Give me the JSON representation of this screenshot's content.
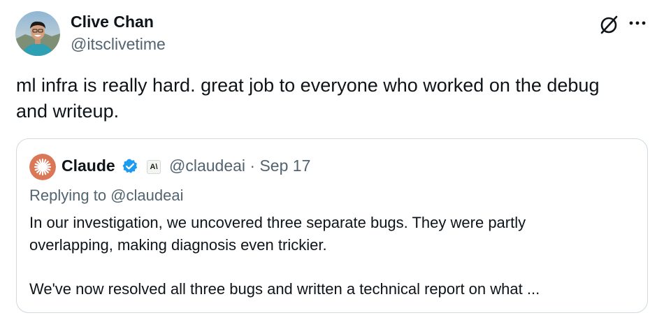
{
  "tweet": {
    "author": {
      "name": "Clive Chan",
      "handle": "@itsclivetime",
      "avatar_icon": "profile-photo"
    },
    "header_icons": [
      "x-logo-icon",
      "more-options-icon"
    ],
    "text_lines": [
      "ml infra is really hard. great job to everyone who worked on the debug",
      "and writeup."
    ],
    "quoted": {
      "name": "Claude",
      "verified_color": "#1d9bf0",
      "affiliate_badge": "A\\",
      "handle": "@claudeai",
      "separator": "·",
      "date": "Sep 17",
      "handle_date": "@claudeai · Sep 17",
      "replying_to": "Replying to @claudeai",
      "text_lines": [
        "In our investigation, we uncovered three separate bugs. They were partly",
        "overlapping, making diagnosis even trickier."
      ],
      "paragraph2": "We've now resolved all three bugs and written a technical report on what ...",
      "avatar_color": "#d97757"
    }
  },
  "colors": {
    "text_primary": "#0f1419",
    "text_secondary": "#536471",
    "border": "#cfd9de"
  }
}
